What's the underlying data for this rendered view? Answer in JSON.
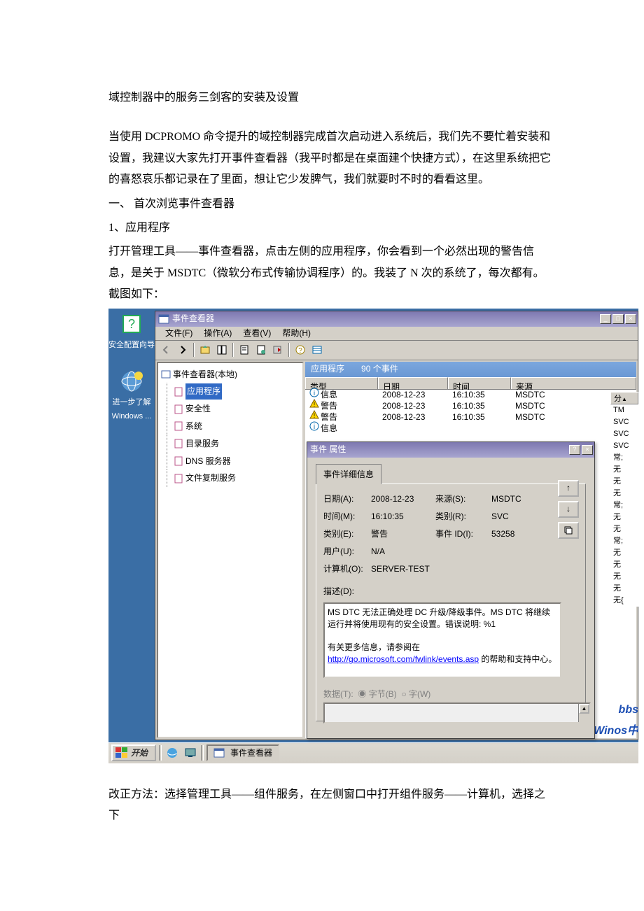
{
  "doc": {
    "title": "域控制器中的服务三剑客的安装及设置",
    "p1": "当使用 DCPROMO 命令提升的域控制器完成首次启动进入系统后，我们先不要忙着安装和设置，我建议大家先打开事件查看器（我平时都是在桌面建个快捷方式），在这里系统把它的喜怒哀乐都记录在了里面，想让它少发脾气，我们就要时不时的看看这里。",
    "h1": "一、              首次浏览事件查看器",
    "h2": "1、应用程序",
    "p2": "打开管理工具——事件查看器，点击左侧的应用程序，你会看到一个必然出现的警告信息，是关于 MSDTC（微软分布式传输协调程序）的。我装了 N 次的系统了，每次都有。截图如下：",
    "p3": "改正方法：选择管理工具——组件服务，在左侧窗口中打开组件服务——计算机，选择之下"
  },
  "desktop": {
    "icon1": "安全配置向导",
    "icon2_l1": "进一步了解",
    "icon2_l2": "Windows ..."
  },
  "eventviewer": {
    "title": "事件查看器",
    "menus": {
      "file": "文件(F)",
      "action": "操作(A)",
      "view": "查看(V)",
      "help": "帮助(H)"
    },
    "tree": {
      "root": "事件查看器(本地)",
      "items": [
        "应用程序",
        "安全性",
        "系统",
        "目录服务",
        "DNS 服务器",
        "文件复制服务"
      ]
    },
    "list": {
      "header_title": "应用程序",
      "header_count": "90 个事件",
      "cols": {
        "type": "类型",
        "date": "日期",
        "time": "时间",
        "source": "来源",
        "cat": "分"
      },
      "rows": [
        {
          "icon": "info",
          "type": "信息",
          "date": "2008-12-23",
          "time": "16:10:35",
          "source": "MSDTC",
          "cat": "TM"
        },
        {
          "icon": "warn",
          "type": "警告",
          "date": "2008-12-23",
          "time": "16:10:35",
          "source": "MSDTC",
          "cat": "SVC"
        },
        {
          "icon": "warn",
          "type": "警告",
          "date": "2008-12-23",
          "time": "16:10:35",
          "source": "MSDTC",
          "cat": "SVC"
        },
        {
          "icon": "info",
          "type": "信息",
          "date": "",
          "time": "",
          "source": "",
          "cat": "SVC"
        }
      ],
      "sidecells": [
        "SVC",
        "常;",
        "无",
        "无",
        "无",
        "常;",
        "无",
        "无",
        "常;",
        "无",
        "无",
        "无",
        "无",
        "无{"
      ]
    }
  },
  "prop": {
    "title": "事件 属性",
    "tab": "事件详细信息",
    "labels": {
      "date": "日期(A):",
      "time": "时间(M):",
      "type": "类别(E):",
      "user": "用户(U):",
      "computer": "计算机(O):",
      "source": "来源(S):",
      "category": "类别(R):",
      "eventid": "事件 ID(I):",
      "desc": "描述(D):",
      "data": "数据(T):",
      "byte": "字节(B)",
      "word": "字(W)"
    },
    "values": {
      "date": "2008-12-23",
      "time": "16:10:35",
      "type": "警告",
      "user": "N/A",
      "computer": "SERVER-TEST",
      "source": "MSDTC",
      "category": "SVC",
      "eventid": "53258"
    },
    "desc_l1": "MS DTC 无法正确处理 DC 升级/降级事件。MS DTC 将继续运行并将使用现有的安全设置。错误说明: %1",
    "desc_l2": "有关更多信息，请参阅在 ",
    "desc_link": "http://go.microsoft.com/fwlink/events.asp",
    "desc_l3": " 的帮助和支持中心。"
  },
  "taskbar": {
    "start": "开始",
    "task1": "事件查看器",
    "brand1": "bbs",
    "brand2": "Winos中"
  }
}
